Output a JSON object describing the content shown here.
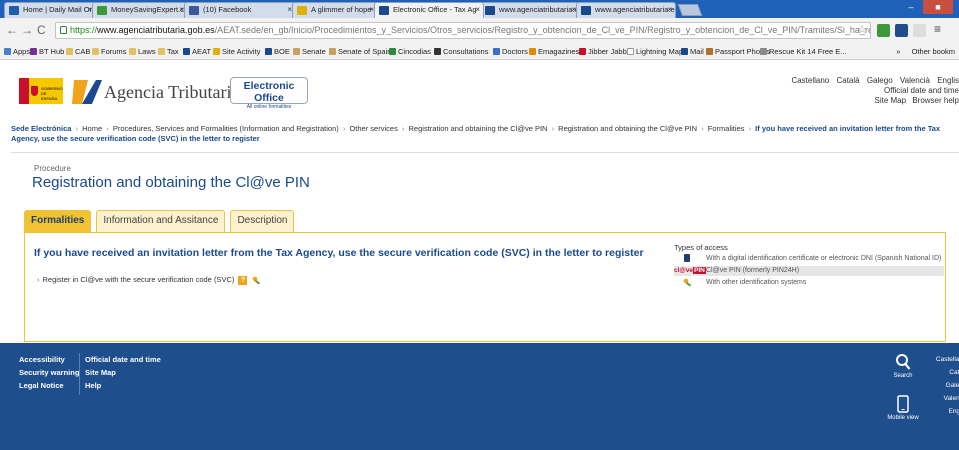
{
  "browser": {
    "tabs": [
      {
        "label": "Home | Daily Mail Online",
        "active": false
      },
      {
        "label": "MoneySavingExpert.com",
        "active": false
      },
      {
        "label": "(10) Facebook",
        "active": false
      },
      {
        "label": "A glimmer of hope for po",
        "active": false
      },
      {
        "label": "Electronic Office - Tax Ag",
        "active": true
      },
      {
        "label": "www.agenciatributaria.es",
        "active": false
      },
      {
        "label": "www.agenciatributaria.es",
        "active": false
      }
    ],
    "url_scheme": "https://",
    "url_host": "www.agenciatributaria.gob.es",
    "url_path": "/AEAT.sede/en_gb/Inicio/Procedimientos_y_Servicios/Otros_servicios/Registro_y_obtencion_de_Cl_ve_PIN/Registro_y_obtencion_de_Cl_ve_PIN/Tramites/Si_ha_recibido_una_carta_invitacion_de_la_",
    "bookmarks": [
      "Apps",
      "BT Hub",
      "CAB",
      "Forums",
      "Laws",
      "Tax",
      "AEAT",
      "Site Activity",
      "BOE",
      "Senate",
      "Senate of Spain",
      "Cincodias",
      "Consultations",
      "Doctors",
      "Emagazines",
      "Jibber Jabber",
      "Lightning Map",
      "Mail",
      "Passport Photos",
      "Rescue Kit 14 Free E..."
    ],
    "other_bookmarks": "Other bookm"
  },
  "header": {
    "spain_logo_text": "GOBIERNO DE ESPAÑA",
    "brand": "Agencia Tributaria",
    "eo_title": "Electronic Office",
    "eo_sub": "All online formalities",
    "languages": [
      "Castellano",
      "Català",
      "Galego",
      "Valencià",
      "Englis"
    ],
    "official_date": "Official date and time",
    "site_map": "Site Map",
    "browser_help": "Browser help"
  },
  "breadcrumb": {
    "first": "Sede Electrónica",
    "items": [
      "Home",
      "Procedures, Services and Formalities (Information and Registration)",
      "Other services",
      "Registration and obtaining the Cl@ve PIN",
      "Registration and obtaining the Cl@ve PIN",
      "Formalities"
    ],
    "current": "If you have received an invitation letter from the Tax Agency, use the secure verification code (SVC) in the letter to register"
  },
  "procedure": {
    "label": "Procedure",
    "title": "Registration and obtaining the Cl@ve PIN"
  },
  "tabs": [
    "Formalities",
    "Information and Assitance",
    "Description"
  ],
  "panel": {
    "title": "If you have received an invitation letter from the Tax Agency, use the secure verification code (SVC) in the letter to register",
    "link": "Register in Cl@ve with the secure verification code (SVC)",
    "help_badge": "?"
  },
  "access": {
    "title": "Types of access",
    "items": [
      "With a digital identification certificate or electronic DNI (Spanish National ID)",
      "Cl@ve PIN (formerly PIN24H)",
      "With other identification systems"
    ],
    "clave_logo": "cl@ve",
    "clave_pin": "PIN"
  },
  "footer": {
    "col1": [
      "Accessibility",
      "Security warning",
      "Legal Notice"
    ],
    "col2": [
      "Official date and time",
      "Site Map",
      "Help"
    ],
    "search": "Search",
    "mobile": "Mobile view",
    "langs": [
      "Castellan",
      "Cata",
      "Galeg",
      "Valenc",
      "Engli"
    ]
  },
  "colors": {
    "brand_blue": "#1a4990",
    "tab_yellow": "#f1c232",
    "footer_blue": "#1f4e8c"
  }
}
